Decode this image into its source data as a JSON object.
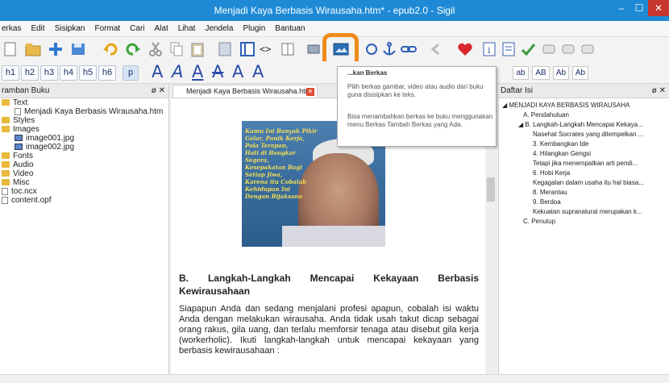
{
  "window": {
    "title": "Menjadi Kaya Berbasis Wirausaha.htm* - epub2.0 - Sigil",
    "min": "–",
    "max": "☐",
    "close": "✕"
  },
  "menu": [
    "erkas",
    "Edit",
    "Sisipkan",
    "Format",
    "Cari",
    "Alat",
    "Lihat",
    "Jendela",
    "Plugin",
    "Bantuan"
  ],
  "headings": [
    "h1",
    "h2",
    "h3",
    "h4",
    "h5",
    "h6",
    "p"
  ],
  "ab_buttons": [
    "ab",
    "AB",
    "Ab",
    "Ab"
  ],
  "left_panel": {
    "title": "ramban Buku",
    "controls": "ø ✕",
    "items": [
      {
        "label": "Text",
        "type": "folder",
        "indent": 0
      },
      {
        "label": "Menjadi Kaya Berbasis Wirausaha.htm",
        "type": "file",
        "indent": 1
      },
      {
        "label": "Styles",
        "type": "folder",
        "indent": 0
      },
      {
        "label": "Images",
        "type": "folder",
        "indent": 0
      },
      {
        "label": "image001.jpg",
        "type": "image",
        "indent": 1
      },
      {
        "label": "image002.jpg",
        "type": "image",
        "indent": 1
      },
      {
        "label": "Fonts",
        "type": "folder",
        "indent": 0
      },
      {
        "label": "Audio",
        "type": "folder",
        "indent": 0
      },
      {
        "label": "Video",
        "type": "folder",
        "indent": 0
      },
      {
        "label": "Misc",
        "type": "folder",
        "indent": 0
      },
      {
        "label": "toc.ncx",
        "type": "file",
        "indent": 0
      },
      {
        "label": "content.opf",
        "type": "file",
        "indent": 0
      }
    ]
  },
  "editor": {
    "tab_label": "Menjadi Kaya Berbasis Wirausaha.htm",
    "tab_close": "✕",
    "image_quote": [
      "Kamu Ini Banyak Pikir",
      "Gelar, Panik Kerja,",
      "Pola Terapan,",
      "Hati di Bangkar Segera,",
      "Kesepakatan Bagi",
      "Setiap Jiwa,",
      "Karena itu Cobalah",
      "Kehidupan Ini",
      "Dengan Bijaksana"
    ],
    "heading": "B. Langkah-Langkah Mencapai Kekayaan Berbasis Kewirausahaan",
    "paragraph": "Siapapun Anda dan sedang menjalani profesi apapun, cobalah isi waktu Anda dengan melakukan wirausaha. Anda tidak usah takut dicap sebagai orang rakus, gila uang, dan terlalu memforsir tenaga atau disebut gila kerja (workerholic). Ikuti langkah-langkah untuk mencapai kekayaan yang berbasis kewirausahaan :"
  },
  "tooltip": {
    "title": "...kan Berkas",
    "p1": "Pilih berkas gambar, video atau audio dari buku guna disisipkan ke teks.",
    "p2": "Bisa menambahkan berkas ke buku menggunakan menu Berkas Tambah Berkas yang Ada."
  },
  "right_panel": {
    "title": "Daftar Isi",
    "controls": "ø ✕",
    "items": [
      {
        "label": "◢ MENJADI KAYA BERBASIS WIRAUSAHA",
        "indent": 0
      },
      {
        "label": "A. Pendahuluan",
        "indent": 1
      },
      {
        "label": "◢ B. Langkah-Langkah Mencapai Kekaya...",
        "indent": 1
      },
      {
        "label": "Nasehat Socrates yang ditempelkan ...",
        "indent": 2
      },
      {
        "label": "3. Kembangkan Ide",
        "indent": 2
      },
      {
        "label": "4. Hilangkan Gengsi",
        "indent": 2
      },
      {
        "label": "Tetapi jika menempatkan arti pendi...",
        "indent": 2
      },
      {
        "label": "6. Hobi Kerja",
        "indent": 2
      },
      {
        "label": "Kegagalan dalam usaha itu hal biasa...",
        "indent": 2
      },
      {
        "label": "8. Merantau",
        "indent": 2
      },
      {
        "label": "9. Berdoa",
        "indent": 2
      },
      {
        "label": "Kekuatan supranatural merupakan k...",
        "indent": 2
      },
      {
        "label": "C. Penutup",
        "indent": 1
      }
    ]
  },
  "colors": {
    "titlebar": "#1e8ad6",
    "highlight": "#f08b1d",
    "close": "#c7372f"
  }
}
